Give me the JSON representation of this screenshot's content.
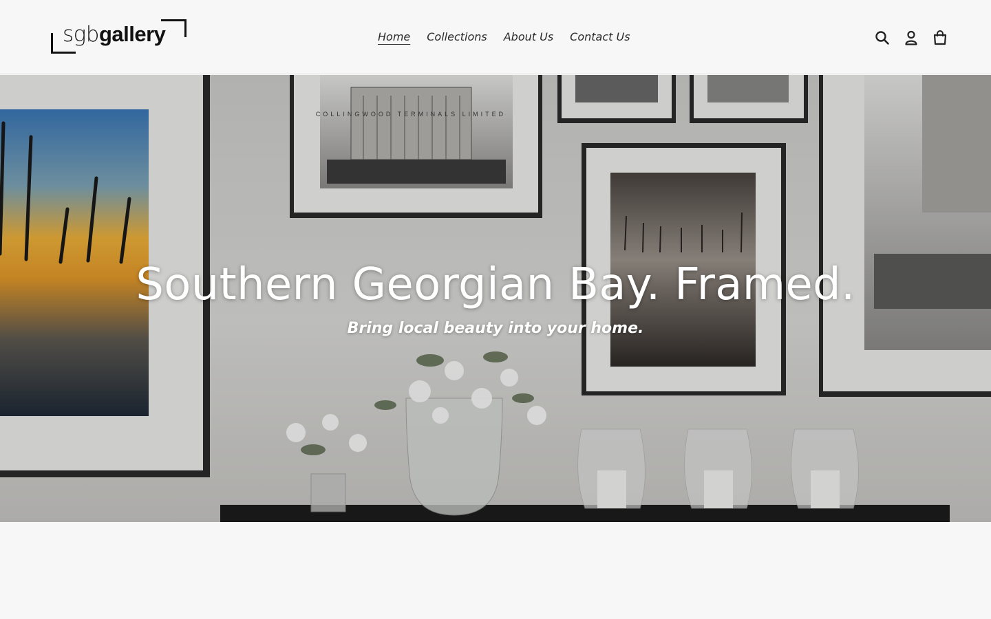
{
  "brand": {
    "logo_thin": "sgb",
    "logo_bold": "gallery"
  },
  "nav": {
    "items": [
      {
        "label": "Home",
        "active": true
      },
      {
        "label": "Collections",
        "active": false
      },
      {
        "label": "About Us",
        "active": false
      },
      {
        "label": "Contact Us",
        "active": false
      }
    ]
  },
  "header_icons": [
    {
      "name": "search-icon",
      "label": "Search"
    },
    {
      "name": "account-icon",
      "label": "Log in"
    },
    {
      "name": "cart-icon",
      "label": "Cart"
    }
  ],
  "hero": {
    "title": "Southern Georgian Bay. Framed.",
    "subtitle": "Bring local beauty into your home.",
    "frame_sign_text": "COLLINGWOOD TERMINALS LIMITED"
  },
  "colors": {
    "page_background": "#f7f7f7",
    "text": "#222222",
    "hero_text": "#ffffff"
  }
}
